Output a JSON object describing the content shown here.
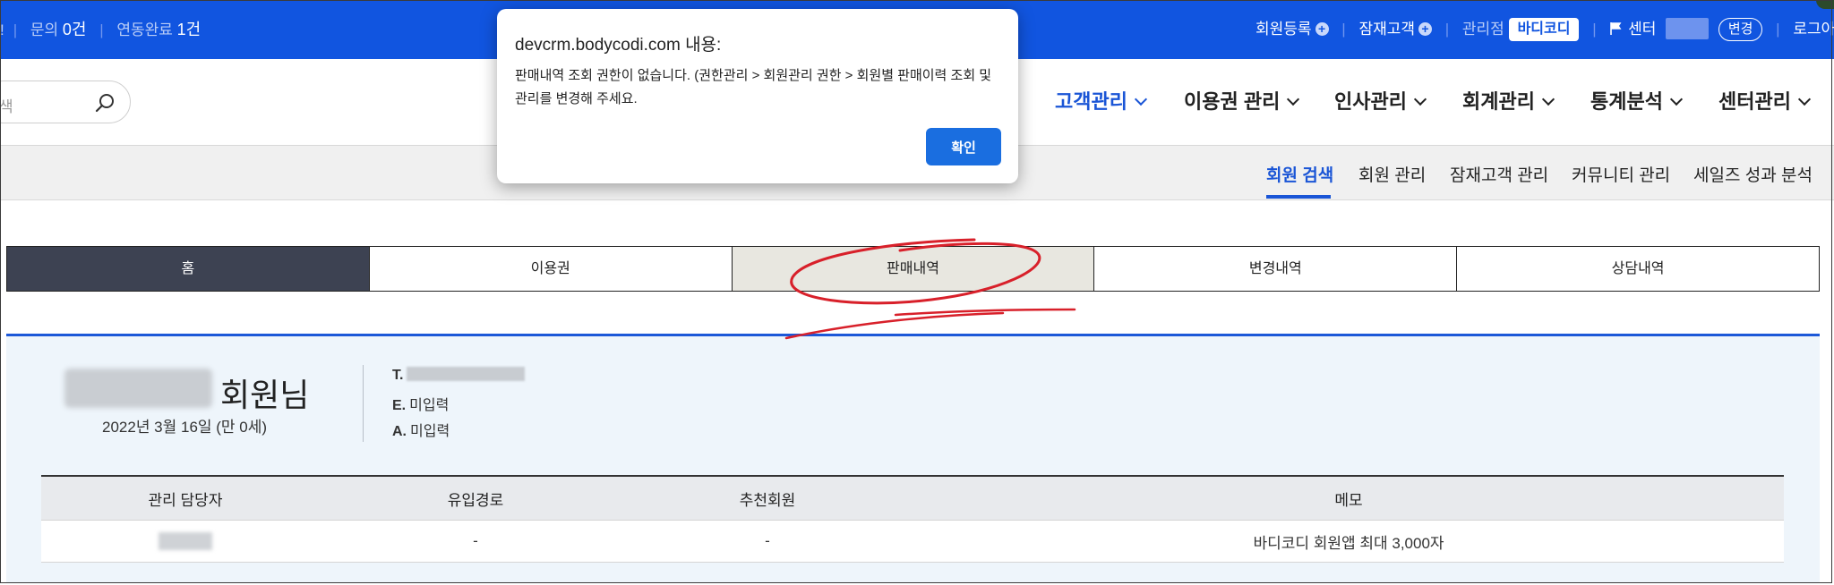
{
  "topbar": {
    "inquiry_label": "문의",
    "inquiry_count": "0건",
    "sync_done_label": "연동완료",
    "sync_done_count": "1건",
    "register_member": "회원등록",
    "potential_customer": "잠재고객",
    "managed_branch_label": "관리점",
    "branch_name": "바디코디",
    "center_label": "센터",
    "change_button": "변경",
    "logout": "로그아웃"
  },
  "search": {
    "placeholder_fragment": "색"
  },
  "main_nav": [
    {
      "label": "고객관리",
      "active": true
    },
    {
      "label": "이용권 관리",
      "active": false
    },
    {
      "label": "인사관리",
      "active": false
    },
    {
      "label": "회계관리",
      "active": false
    },
    {
      "label": "통계분석",
      "active": false
    },
    {
      "label": "센터관리",
      "active": false
    }
  ],
  "sub_nav": [
    {
      "label": "회원 검색",
      "active": true
    },
    {
      "label": "회원 관리",
      "active": false
    },
    {
      "label": "잠재고객 관리",
      "active": false
    },
    {
      "label": "커뮤니티 관리",
      "active": false
    },
    {
      "label": "세일즈 성과 분석",
      "active": false
    }
  ],
  "tabs": [
    {
      "label": "홈",
      "state": "home"
    },
    {
      "label": "이용권",
      "state": "normal"
    },
    {
      "label": "판매내역",
      "state": "selected"
    },
    {
      "label": "변경내역",
      "state": "normal"
    },
    {
      "label": "상담내역",
      "state": "normal"
    }
  ],
  "member": {
    "name_suffix": "회원님",
    "birth": "2022년 3월 16일 (만 0세)",
    "tel_label": "T.",
    "email_label": "E.",
    "email_value": "미입력",
    "address_label": "A.",
    "address_value": "미입력"
  },
  "info_table": {
    "headers": [
      "관리 담당자",
      "유입경로",
      "추천회원",
      "메모"
    ],
    "row": {
      "channel": "-",
      "referrer": "-",
      "memo": "바디코디 회원앱 최대 3,000자"
    }
  },
  "dialog": {
    "title": "devcrm.bodycodi.com 내용:",
    "message": "판매내역 조회 권한이 없습니다. (권한관리 > 회원관리 권한 > 회원별 판매이력 조회 및 관리를 변경해 주세요.",
    "ok_label": "확인"
  },
  "colors": {
    "topbar_bg": "#1155e0",
    "accent": "#1a55d6",
    "home_tab_bg": "#3d4252",
    "selected_tab_bg": "#e8e7e0",
    "annotation_red": "#d8202a",
    "ok_button": "#1a6ee0"
  }
}
